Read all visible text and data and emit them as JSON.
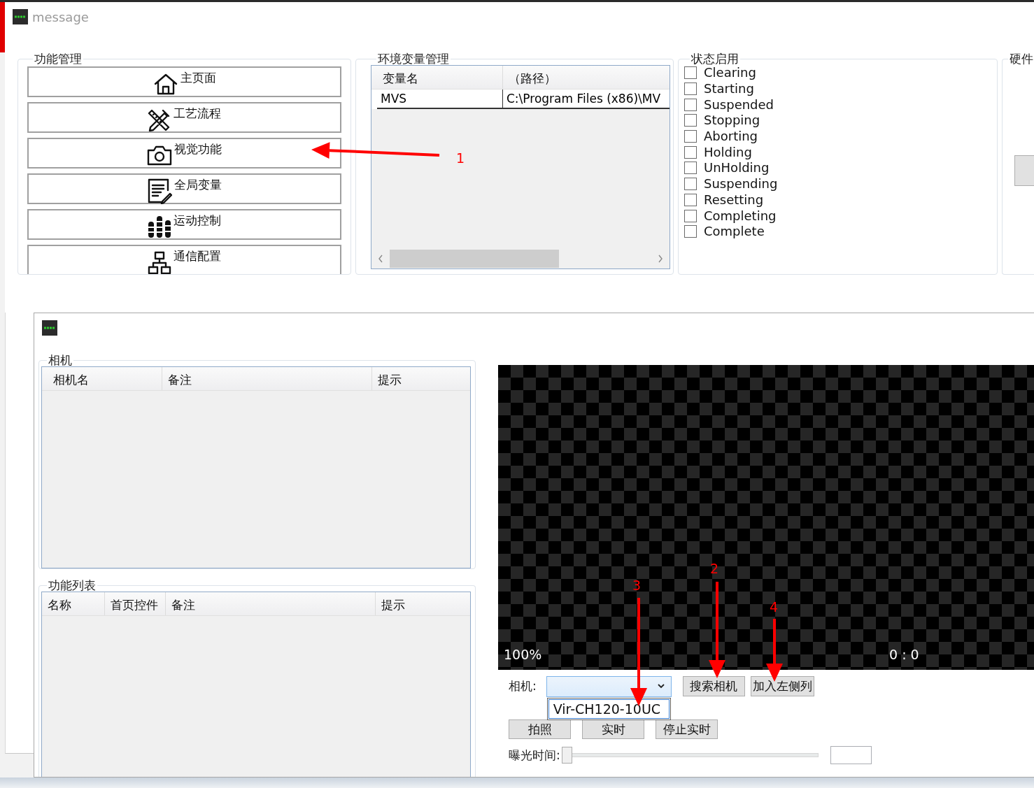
{
  "window": {
    "title": "message"
  },
  "function_group": {
    "title": "功能管理",
    "buttons": [
      {
        "label": "主页面",
        "kind": "home"
      },
      {
        "label": "工艺流程",
        "kind": "tools"
      },
      {
        "label": "视觉功能",
        "kind": "camera"
      },
      {
        "label": "全局变量",
        "kind": "note"
      },
      {
        "label": "运动控制",
        "kind": "bars"
      },
      {
        "label": "通信配置",
        "kind": "network"
      }
    ]
  },
  "env_group": {
    "title": "环境变量管理",
    "columns": [
      "变量名",
      "（路径）"
    ],
    "rows": [
      [
        "MVS",
        "C:\\Program Files (x86)\\MV"
      ]
    ]
  },
  "status_group": {
    "title": "状态启用",
    "items": [
      {
        "label": "Clearing",
        "checked": false
      },
      {
        "label": "Starting",
        "checked": false
      },
      {
        "label": "Suspended",
        "checked": false
      },
      {
        "label": "Stopping",
        "checked": false
      },
      {
        "label": "Aborting",
        "checked": false
      },
      {
        "label": "Holding",
        "checked": false
      },
      {
        "label": "UnHolding",
        "checked": false
      },
      {
        "label": "Suspending",
        "checked": false
      },
      {
        "label": "Resetting",
        "checked": false
      },
      {
        "label": "Completing",
        "checked": false
      },
      {
        "label": "Complete",
        "checked": false
      }
    ]
  },
  "hardware_group": {
    "title": "硬件"
  },
  "camera_window": {
    "camera_group": {
      "title": "相机",
      "columns": [
        "相机名",
        "备注",
        "提示"
      ]
    },
    "function_list_group": {
      "title": "功能列表",
      "columns": [
        "名称",
        "首页控件",
        "备注",
        "提示"
      ]
    },
    "viewer": {
      "zoom": "100%",
      "coords": "0 : 0"
    },
    "camera_label": "相机:",
    "camera_select": {
      "expanded": true,
      "options": [
        "Vir-CH120-10UC"
      ]
    },
    "top_buttons": [
      "搜索相机",
      "加入左侧列"
    ],
    "bottom_buttons": [
      "拍照",
      "实时",
      "停止实时"
    ],
    "exposure": {
      "label": "曝光时间:",
      "level": 0
    }
  },
  "annotations": [
    {
      "label": "1",
      "kind": "left"
    },
    {
      "label": "2",
      "kind": "down"
    },
    {
      "label": "3",
      "kind": "down"
    },
    {
      "label": "4",
      "kind": "down"
    }
  ]
}
